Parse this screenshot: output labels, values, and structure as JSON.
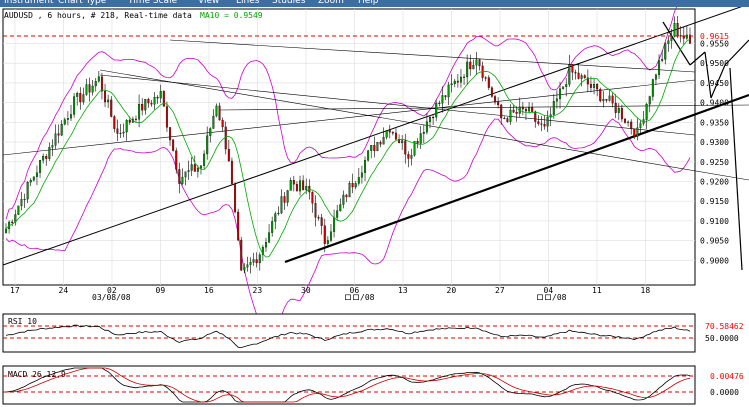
{
  "menu": [
    "Instrument",
    "Chart Type",
    "Time Scale",
    "View",
    "Lines",
    "Studies",
    "Zoom",
    "Help"
  ],
  "header": {
    "symbol_info": "AUDUSD , 6 hours, # 218, Real-time data",
    "ma_label": "MA10 = 0.9549"
  },
  "colors": {
    "menu": "#3a6ea5",
    "candle_up": "#009900",
    "candle_down": "#cc0000",
    "ma": "#00aa00",
    "bands": "#cc00cc",
    "ref_line": "#e00000",
    "trend": "#000000",
    "price_label": "#ff0000"
  },
  "price_panel": {
    "current_price_label": "0.9615",
    "y_ticks": [
      "0.9550",
      "0.9500",
      "0.9450",
      "0.9400",
      "0.9350",
      "0.9300",
      "0.9250",
      "0.9200",
      "0.9150",
      "0.9100",
      "0.9050",
      "0.9000"
    ],
    "x_ticks": [
      "17",
      "24",
      "02",
      "09",
      "16",
      "23",
      "30",
      "06",
      "13",
      "20",
      "27",
      "04",
      "11",
      "18"
    ],
    "month_labels": [
      "03/08/08",
      "ロロ/08",
      "ロロ/08"
    ]
  },
  "rsi_panel": {
    "title": "RSI 10",
    "ref_high": "70.58462",
    "ref_mid": "50.0000"
  },
  "macd_panel": {
    "title": "MACD 26,12,9",
    "value": "0.00476",
    "ref": "0.0000"
  },
  "chart_data": {
    "type": "candlestick",
    "title": "AUDUSD , 6 hours, # 218, Real-time data",
    "ylim": [
      0.895,
      0.963
    ],
    "anchors": [
      {
        "i": 0,
        "p": 0.908
      },
      {
        "i": 10,
        "p": 0.923
      },
      {
        "i": 22,
        "p": 0.94
      },
      {
        "i": 30,
        "p": 0.946
      },
      {
        "i": 36,
        "p": 0.932
      },
      {
        "i": 44,
        "p": 0.939
      },
      {
        "i": 50,
        "p": 0.942
      },
      {
        "i": 56,
        "p": 0.921
      },
      {
        "i": 63,
        "p": 0.924
      },
      {
        "i": 68,
        "p": 0.94
      },
      {
        "i": 72,
        "p": 0.926
      },
      {
        "i": 76,
        "p": 0.896
      },
      {
        "i": 82,
        "p": 0.902
      },
      {
        "i": 92,
        "p": 0.92
      },
      {
        "i": 98,
        "p": 0.917
      },
      {
        "i": 103,
        "p": 0.905
      },
      {
        "i": 110,
        "p": 0.917
      },
      {
        "i": 118,
        "p": 0.928
      },
      {
        "i": 124,
        "p": 0.934
      },
      {
        "i": 130,
        "p": 0.927
      },
      {
        "i": 138,
        "p": 0.938
      },
      {
        "i": 146,
        "p": 0.946
      },
      {
        "i": 152,
        "p": 0.952
      },
      {
        "i": 160,
        "p": 0.936
      },
      {
        "i": 168,
        "p": 0.938
      },
      {
        "i": 174,
        "p": 0.933
      },
      {
        "i": 182,
        "p": 0.948
      },
      {
        "i": 186,
        "p": 0.946
      },
      {
        "i": 192,
        "p": 0.942
      },
      {
        "i": 198,
        "p": 0.938
      },
      {
        "i": 204,
        "p": 0.932
      },
      {
        "i": 210,
        "p": 0.948
      },
      {
        "i": 216,
        "p": 0.959
      },
      {
        "i": 221,
        "p": 0.955
      }
    ]
  }
}
